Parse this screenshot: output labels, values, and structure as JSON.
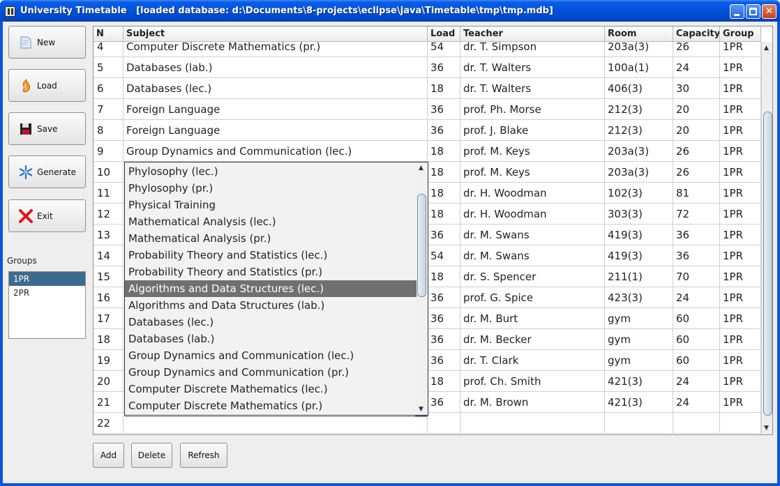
{
  "window": {
    "title": "University Timetable   [loaded database: d:\\Documents\\8-projects\\eclipse\\java\\Timetable\\tmp\\tmp.mdb]"
  },
  "sidebar": {
    "buttons": [
      {
        "label": "New",
        "icon": "new-file-icon"
      },
      {
        "label": "Load",
        "icon": "load-icon"
      },
      {
        "label": "Save",
        "icon": "floppy-disk-icon"
      },
      {
        "label": "Generate",
        "icon": "snowflake-icon"
      },
      {
        "label": "Exit",
        "icon": "red-x-icon"
      }
    ],
    "groups_label": "Groups",
    "groups": [
      "1PR",
      "2PR"
    ],
    "selected_group": "1PR"
  },
  "table": {
    "columns": [
      "N",
      "Subject",
      "Load",
      "Teacher",
      "Room",
      "Capacity",
      "Group"
    ],
    "rows": [
      [
        "4",
        "Computer Discrete Mathematics (pr.)",
        "54",
        "dr. T. Simpson",
        "203a(3)",
        "26",
        "1PR"
      ],
      [
        "5",
        "Databases (lab.)",
        "36",
        "dr. T. Walters",
        "100a(1)",
        "24",
        "1PR"
      ],
      [
        "6",
        "Databases (lec.)",
        "18",
        "dr. T. Walters",
        "406(3)",
        "30",
        "1PR"
      ],
      [
        "7",
        "Foreign Language",
        "36",
        "prof. Ph. Morse",
        "212(3)",
        "20",
        "1PR"
      ],
      [
        "8",
        "Foreign Language",
        "36",
        "prof. J. Blake",
        "212(3)",
        "20",
        "1PR"
      ],
      [
        "9",
        "Group Dynamics and Communication (lec.)",
        "18",
        "prof. M. Keys",
        "203a(3)",
        "26",
        "1PR"
      ],
      [
        "10",
        "",
        "18",
        "prof. M. Keys",
        "203a(3)",
        "26",
        "1PR"
      ],
      [
        "11",
        "",
        "18",
        "dr. H. Woodman",
        "102(3)",
        "81",
        "1PR"
      ],
      [
        "12",
        "",
        "18",
        "dr. H. Woodman",
        "303(3)",
        "72",
        "1PR"
      ],
      [
        "13",
        "",
        "36",
        "dr. M. Swans",
        "419(3)",
        "36",
        "1PR"
      ],
      [
        "14",
        "",
        "54",
        "dr. M. Swans",
        "419(3)",
        "36",
        "1PR"
      ],
      [
        "15",
        "",
        "18",
        "dr. S. Spencer",
        "211(1)",
        "70",
        "1PR"
      ],
      [
        "16",
        "",
        "36",
        "prof. G. Spice",
        "423(3)",
        "24",
        "1PR"
      ],
      [
        "17",
        "",
        "36",
        "dr. M. Burt",
        "gym",
        "60",
        "1PR"
      ],
      [
        "18",
        "",
        "36",
        "dr. M. Becker",
        "gym",
        "60",
        "1PR"
      ],
      [
        "19",
        "",
        "36",
        "dr. T. Clark",
        "gym",
        "60",
        "1PR"
      ],
      [
        "20",
        "",
        "18",
        "prof. Ch. Smith",
        "421(3)",
        "24",
        "1PR"
      ],
      [
        "21",
        "",
        "36",
        "dr. M. Brown",
        "421(3)",
        "24",
        "1PR"
      ],
      [
        "22",
        "",
        "",
        "",
        "",
        "",
        ""
      ]
    ]
  },
  "dropdown": {
    "options": [
      "Phylosophy (lec.)",
      "Phylosophy (pr.)",
      "Physical Training",
      "Mathematical Analysis (lec.)",
      "Mathematical Analysis (pr.)",
      "Probability Theory and Statistics (lec.)",
      "Probability Theory and Statistics (pr.)",
      "Algorithms and Data Structures (lec.)",
      "Algorithms and Data Structures (lab.)",
      "Databases (lec.)",
      "Databases (lab.)",
      "Group Dynamics and Communication (lec.)",
      "Group Dynamics and Communication (pr.)",
      "Computer Discrete Mathematics (lec.)",
      "Computer Discrete Mathematics (pr.)"
    ],
    "highlighted": "Algorithms and Data Structures (lec.)",
    "editor_value": ""
  },
  "actions": {
    "add": "Add",
    "delete": "Delete",
    "refresh": "Refresh"
  },
  "colors": {
    "title_bar": "#0152d8",
    "selection": "#3d6b8f",
    "dropdown_highlight": "#707070"
  }
}
